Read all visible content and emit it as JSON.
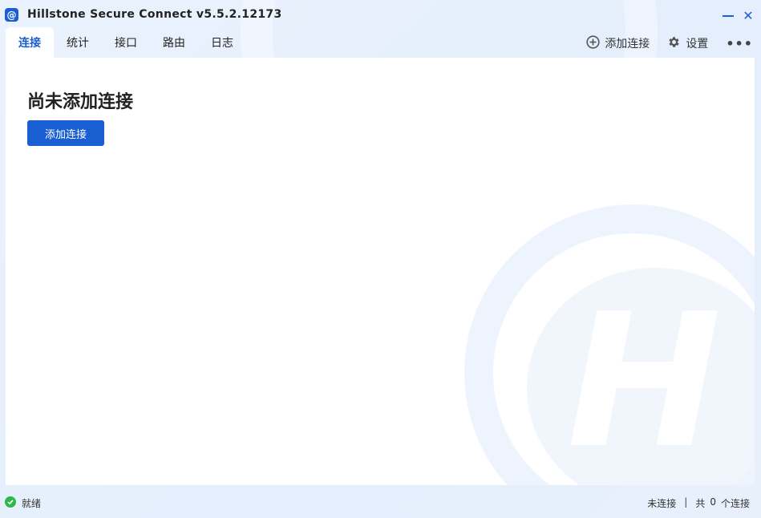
{
  "window": {
    "title": "Hillstone Secure Connect v5.5.2.12173",
    "app_icon_glyph": "@",
    "close_glyph": "✕"
  },
  "tabs": [
    {
      "label": "连接",
      "active": true
    },
    {
      "label": "统计",
      "active": false
    },
    {
      "label": "接口",
      "active": false
    },
    {
      "label": "路由",
      "active": false
    },
    {
      "label": "日志",
      "active": false
    }
  ],
  "actions": {
    "add_connection_label": "添加连接",
    "settings_label": "设置",
    "more_glyph": "•••"
  },
  "main": {
    "empty_title": "尚未添加连接",
    "add_button_label": "添加连接",
    "watermark_letter": "H"
  },
  "status": {
    "ready_label": "就绪",
    "connection_state": "未连接",
    "separator": "|",
    "total_prefix": "共",
    "total_count": "0",
    "total_suffix": "个连接"
  },
  "colors": {
    "accent": "#1a5fd1",
    "status_ok": "#2eb84a",
    "window_bg": "#e9f1fc"
  },
  "icons": {
    "add": "plus-circle-icon",
    "settings": "gear-icon",
    "more": "more-horizontal-icon",
    "status": "check-circle-icon"
  }
}
